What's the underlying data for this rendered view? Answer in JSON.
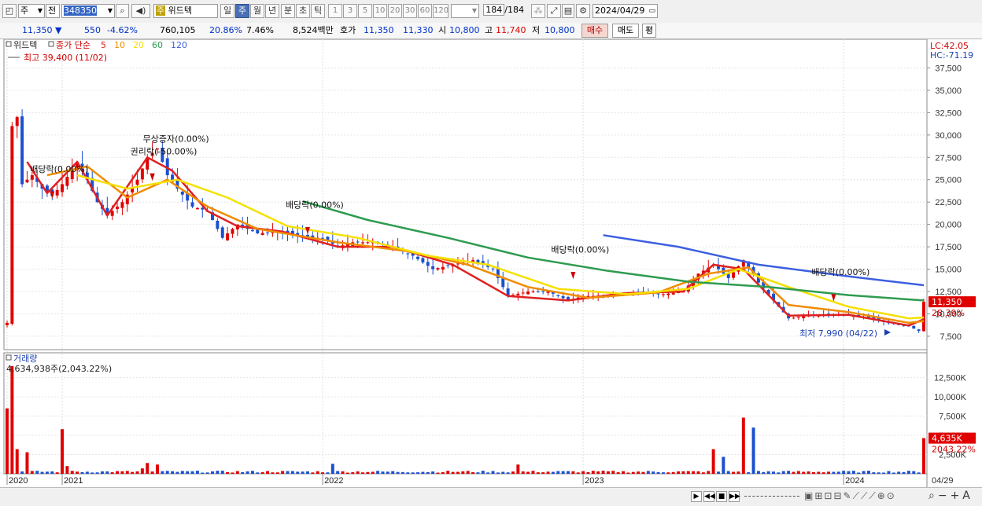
{
  "toolbar": {
    "period_unit": "주",
    "prev_label": "전",
    "code": "348350",
    "stock_name": "위드텍",
    "stock_tag": "주",
    "period_tabs": [
      "일",
      "주",
      "월",
      "년",
      "분",
      "초",
      "틱"
    ],
    "selected_period": "주",
    "interval_buttons": [
      "1",
      "3",
      "5",
      "10",
      "20",
      "30",
      "60",
      "120"
    ],
    "count": "184",
    "count_total": "/184",
    "date": "2024/04/29"
  },
  "quote": {
    "price": "11,350",
    "change": "550",
    "change_pct": "-4.62%",
    "volume": "760,105",
    "turnover_pct": "20.86%",
    "ratio": "7.46%",
    "amount": "8,524백만",
    "ask_label": "호가",
    "ask1": "11,350",
    "ask2": "11,330",
    "open_label": "시",
    "open": "10,800",
    "high_label": "고",
    "high": "11,740",
    "low_label": "저",
    "low": "10,800",
    "buy_label": "매수",
    "sell_label": "매도",
    "eval_label": "평"
  },
  "price_panel": {
    "name": "위드텍",
    "legend_prefix": "종가 단순",
    "ma_periods": [
      "5",
      "10",
      "20",
      "60",
      "120"
    ],
    "ma_colors": [
      "#e02020",
      "#f08c00",
      "#f5e000",
      "#2e9b50",
      "#3c5fe0"
    ],
    "max_label": "최고 39,400 (11/02)",
    "min_label": "최저 7,990 (04/22)",
    "lc": "LC:42.05",
    "hc": "HC:-71.19",
    "current_price": "11,350",
    "current_pct": "28.39%",
    "events": [
      {
        "label": "배당락(0.00%)",
        "date": "2020-12"
      },
      {
        "label": "권리락(-50.00%)",
        "date": "2021-06"
      },
      {
        "label": "무상증자(0.00%)",
        "date": "2021-06"
      },
      {
        "label": "배당락(0.00%)",
        "date": "2021-12"
      },
      {
        "label": "배당락(0.00%)",
        "date": "2022-12"
      },
      {
        "label": "배당락(0.00%)",
        "date": "2023-12"
      }
    ]
  },
  "volume_panel": {
    "title": "거래량",
    "summary": "4,634,938주(2,043.22%)",
    "current_value": "4,635K",
    "current_pct": "2043.22%",
    "last_date": "04/29"
  },
  "chart_data": {
    "type": "line",
    "y_axis_price": {
      "ticks": [
        7500,
        10000,
        12500,
        15000,
        17500,
        20000,
        22500,
        25000,
        27500,
        30000,
        32500,
        35000,
        37500
      ],
      "min": 6000,
      "max": 40000
    },
    "y_axis_volume": {
      "ticks": [
        2500,
        5000,
        7500,
        10000,
        12500
      ],
      "unit": "K",
      "min": 0,
      "max": 14500
    },
    "x_labels": [
      "2020",
      "2021",
      "2022",
      "2023",
      "2024"
    ],
    "x_label_index": [
      0,
      11,
      63,
      115,
      167
    ],
    "weeks": 184,
    "close_series": [
      {
        "week": 0,
        "close": 9000
      },
      {
        "week": 1,
        "close": 31000
      },
      {
        "week": 2,
        "close": 32000
      },
      {
        "week": 3,
        "close": 24500
      },
      {
        "week": 5,
        "close": 25500
      },
      {
        "week": 7,
        "close": 24000
      },
      {
        "week": 9,
        "close": 23200
      },
      {
        "week": 11,
        "close": 24500
      },
      {
        "week": 14,
        "close": 27000
      },
      {
        "week": 16,
        "close": 25000
      },
      {
        "week": 18,
        "close": 22500
      },
      {
        "week": 20,
        "close": 21000
      },
      {
        "week": 23,
        "close": 22500
      },
      {
        "week": 26,
        "close": 25000
      },
      {
        "week": 28,
        "close": 27500
      },
      {
        "week": 30,
        "close": 28500
      },
      {
        "week": 32,
        "close": 25500
      },
      {
        "week": 34,
        "close": 24000
      },
      {
        "week": 37,
        "close": 22000
      },
      {
        "week": 40,
        "close": 21500
      },
      {
        "week": 43,
        "close": 18500
      },
      {
        "week": 46,
        "close": 20000
      },
      {
        "week": 50,
        "close": 19000
      },
      {
        "week": 55,
        "close": 19200
      },
      {
        "week": 60,
        "close": 18500
      },
      {
        "week": 63,
        "close": 18500
      },
      {
        "week": 66,
        "close": 17500
      },
      {
        "week": 69,
        "close": 18000
      },
      {
        "week": 73,
        "close": 18000
      },
      {
        "week": 77,
        "close": 17500
      },
      {
        "week": 81,
        "close": 16500
      },
      {
        "week": 85,
        "close": 15000
      },
      {
        "week": 89,
        "close": 15500
      },
      {
        "week": 93,
        "close": 16000
      },
      {
        "week": 97,
        "close": 15000
      },
      {
        "week": 100,
        "close": 12000
      },
      {
        "week": 104,
        "close": 12500
      },
      {
        "week": 108,
        "close": 12500
      },
      {
        "week": 112,
        "close": 11500
      },
      {
        "week": 115,
        "close": 12000
      },
      {
        "week": 119,
        "close": 12000
      },
      {
        "week": 123,
        "close": 12300
      },
      {
        "week": 127,
        "close": 12400
      },
      {
        "week": 131,
        "close": 12200
      },
      {
        "week": 135,
        "close": 12500
      },
      {
        "week": 138,
        "close": 14500
      },
      {
        "week": 141,
        "close": 15500
      },
      {
        "week": 144,
        "close": 14000
      },
      {
        "week": 147,
        "close": 16000
      },
      {
        "week": 150,
        "close": 13500
      },
      {
        "week": 153,
        "close": 11500
      },
      {
        "week": 156,
        "close": 9500
      },
      {
        "week": 160,
        "close": 9800
      },
      {
        "week": 164,
        "close": 10000
      },
      {
        "week": 168,
        "close": 9800
      },
      {
        "week": 172,
        "close": 9600
      },
      {
        "week": 176,
        "close": 9000
      },
      {
        "week": 180,
        "close": 8600
      },
      {
        "week": 182,
        "close": 8100
      },
      {
        "week": 183,
        "close": 11350
      }
    ],
    "ma_series": [
      {
        "name": "5",
        "points": [
          [
            4,
            27000
          ],
          [
            8,
            23500
          ],
          [
            14,
            27000
          ],
          [
            20,
            21000
          ],
          [
            28,
            27500
          ],
          [
            33,
            26000
          ],
          [
            40,
            21500
          ],
          [
            46,
            19800
          ],
          [
            55,
            19200
          ],
          [
            66,
            17500
          ],
          [
            77,
            17500
          ],
          [
            89,
            15500
          ],
          [
            100,
            12000
          ],
          [
            112,
            11500
          ],
          [
            123,
            12300
          ],
          [
            135,
            12500
          ],
          [
            141,
            15500
          ],
          [
            147,
            15000
          ],
          [
            156,
            9800
          ],
          [
            168,
            9900
          ],
          [
            180,
            8700
          ],
          [
            183,
            9400
          ]
        ]
      },
      {
        "name": "10",
        "points": [
          [
            8,
            25500
          ],
          [
            16,
            26500
          ],
          [
            24,
            23000
          ],
          [
            32,
            25000
          ],
          [
            40,
            22000
          ],
          [
            50,
            19500
          ],
          [
            66,
            18000
          ],
          [
            80,
            17000
          ],
          [
            92,
            15500
          ],
          [
            104,
            13000
          ],
          [
            116,
            11800
          ],
          [
            130,
            12400
          ],
          [
            140,
            14500
          ],
          [
            148,
            15200
          ],
          [
            156,
            11000
          ],
          [
            168,
            10200
          ],
          [
            180,
            9000
          ],
          [
            183,
            9200
          ]
        ]
      },
      {
        "name": "20",
        "points": [
          [
            14,
            25500
          ],
          [
            24,
            24000
          ],
          [
            34,
            25000
          ],
          [
            44,
            23000
          ],
          [
            56,
            19800
          ],
          [
            70,
            18500
          ],
          [
            84,
            16500
          ],
          [
            96,
            15500
          ],
          [
            110,
            12800
          ],
          [
            124,
            12200
          ],
          [
            136,
            12800
          ],
          [
            146,
            15000
          ],
          [
            156,
            13000
          ],
          [
            168,
            10800
          ],
          [
            180,
            9500
          ],
          [
            183,
            9600
          ]
        ]
      },
      {
        "name": "60",
        "points": [
          [
            59,
            22600
          ],
          [
            72,
            20500
          ],
          [
            88,
            18500
          ],
          [
            104,
            16300
          ],
          [
            120,
            14800
          ],
          [
            136,
            13600
          ],
          [
            152,
            13000
          ],
          [
            168,
            12100
          ],
          [
            183,
            11500
          ]
        ]
      },
      {
        "name": "120",
        "points": [
          [
            119,
            18800
          ],
          [
            134,
            17500
          ],
          [
            150,
            15500
          ],
          [
            168,
            14200
          ],
          [
            183,
            13200
          ]
        ]
      }
    ],
    "volume_series": [
      {
        "week": 0,
        "volume": 8500
      },
      {
        "week": 1,
        "volume": 14000
      },
      {
        "week": 2,
        "volume": 3200
      },
      {
        "week": 4,
        "volume": 2800
      },
      {
        "week": 11,
        "volume": 5800
      },
      {
        "week": 12,
        "volume": 1000
      },
      {
        "week": 27,
        "volume": 700
      },
      {
        "week": 28,
        "volume": 1400
      },
      {
        "week": 30,
        "volume": 1200
      },
      {
        "week": 65,
        "volume": 1300
      },
      {
        "week": 102,
        "volume": 1200
      },
      {
        "week": 141,
        "volume": 3200
      },
      {
        "week": 143,
        "volume": 2200
      },
      {
        "week": 147,
        "volume": 7300
      },
      {
        "week": 149,
        "volume": 6000
      },
      {
        "week": 183,
        "volume": 4635
      }
    ]
  }
}
